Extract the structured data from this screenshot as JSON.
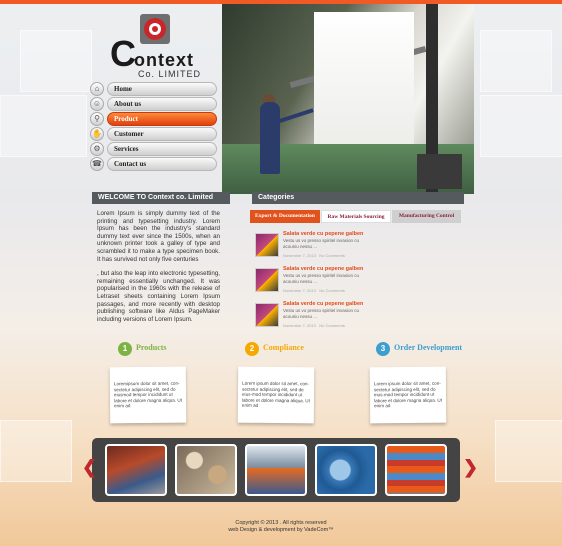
{
  "brand": {
    "logo_initial": "C",
    "name": "ontext",
    "sub": "Co. LIMITED"
  },
  "nav": [
    {
      "label": "Home",
      "icon": "home-icon",
      "glyph": "⌂",
      "active": false
    },
    {
      "label": "About us",
      "icon": "people-icon",
      "glyph": "☺",
      "active": false
    },
    {
      "label": "Product",
      "icon": "search-icon",
      "glyph": "⚲",
      "active": true
    },
    {
      "label": "Customer",
      "icon": "hand-icon",
      "glyph": "✋",
      "active": false
    },
    {
      "label": "Services",
      "icon": "gear-icon",
      "glyph": "⚙",
      "active": false
    },
    {
      "label": "Contact us",
      "icon": "phone-icon",
      "glyph": "☎",
      "active": false
    }
  ],
  "welcome": {
    "title": "WELCOME TO Context co. Limited",
    "para1": "Lorem Ipsum is simply dummy text of the printing and typesetting industry. Lorem Ipsum has been the industry's standard dummy text ever since the 1500s, when an unknown printer took a galley of type and scrambled it to make a type specimen book. It has survived not only five centuries",
    "para2": ", but also the leap into electronic typesetting, remaining essentially unchanged. It was popularised in the 1960s with the release of Letraset sheets containing Lorem Ipsum passages, and more recently with desktop publishing software like Aldus PageMaker including versions of Lorem Ipsum."
  },
  "categories": {
    "title": "Categories",
    "tabs": [
      "Export & Documentation",
      "Raw Materials Sourcing",
      "Manufacturing Control"
    ],
    "items": [
      {
        "title": "Salata verde cu pepene galben",
        "body": "Vestu us vo presso spiritel invasion cu acouniu nessu ...",
        "date": "November 7, 2013",
        "comments": "No Comments"
      },
      {
        "title": "Salata verde cu pepene galben",
        "body": "Vestu us vo presso spiritel invasion cu acouniu nessu ...",
        "date": "November 7, 2013",
        "comments": "No Comments"
      },
      {
        "title": "Salata verde cu pepene galben",
        "body": "Vestu us vo presso spiritel invasion cu acouniu nessu ...",
        "date": "November 7, 2013",
        "comments": "No Comments"
      }
    ]
  },
  "features": [
    {
      "num": "1",
      "title": "Products",
      "color": "#7cb342",
      "note": "Loremipsum dolor sit amet, con-sectetur adipiscing elit, sed do eiusmod tempor incididunt ut labore et dolore magna aliqua. Ut enim ad"
    },
    {
      "num": "2",
      "title": "Compliance",
      "color": "#f5a800",
      "note": "Lorem ipsum dolor sit amet, con-sectetur adipiscing elit, sed do eius-mod tempor incididunt ut labore et dolore magna aliqua. Ut enim ad"
    },
    {
      "num": "3",
      "title": "Order Development",
      "color": "#3d9fd0",
      "note": "Lorem ipsum dolor sit amet, con-sectetur adipiscing elit, sed do eius-mod tempor incididunt ut labore et dolore magna aliqua. Ut enim ad"
    }
  ],
  "gallery": {
    "prev": "❮",
    "next": "❯"
  },
  "footer": {
    "line1": "Copyright © 2013 . All rights reserved",
    "line2": "web Design & development by VadeCom™"
  }
}
